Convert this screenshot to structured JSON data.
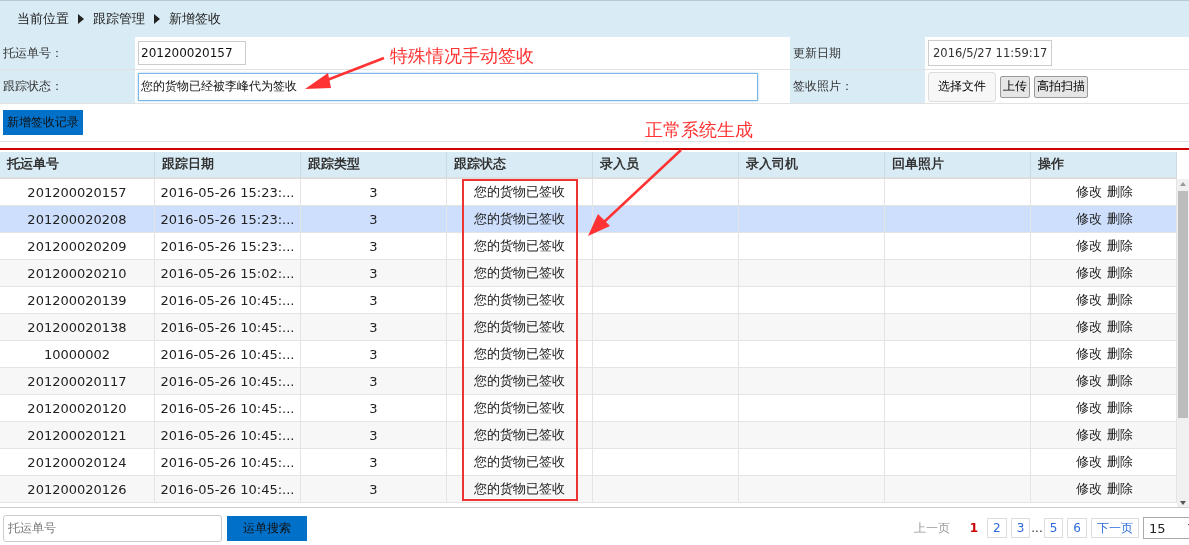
{
  "breadcrumb": [
    "当前位置",
    "跟踪管理",
    "新增签收"
  ],
  "form": {
    "waybill": {
      "label": "托运单号：",
      "value": "201200020157"
    },
    "update_date": {
      "label": "更新日期",
      "value": "2016/5/27 11:59:17"
    },
    "status": {
      "label": "跟踪状态：",
      "value": "您的货物已经被李峰代为签收",
      "focused": true
    },
    "photo": {
      "label": "签收照片：",
      "buttons": [
        "选择文件",
        "上传",
        "高拍扫描"
      ]
    }
  },
  "add_button": "新增签收记录",
  "annotations": [
    {
      "text": "特殊情况手动签收"
    },
    {
      "text": "正常系统生成"
    }
  ],
  "table": {
    "columns": [
      "托运单号",
      "跟踪日期",
      "跟踪类型",
      "跟踪状态",
      "录入员",
      "录入司机",
      "回单照片",
      "操作"
    ],
    "rows": [
      {
        "cells": [
          "201200020157",
          "2016-05-26 15:23:...",
          "3",
          "您的货物已签收",
          "",
          "",
          ""
        ],
        "actions": [
          "修改",
          "删除"
        ],
        "selected": false
      },
      {
        "cells": [
          "201200020208",
          "2016-05-26 15:23:...",
          "3",
          "您的货物已签收",
          "",
          "",
          ""
        ],
        "actions": [
          "修改",
          "删除"
        ],
        "selected": true
      },
      {
        "cells": [
          "201200020209",
          "2016-05-26 15:23:...",
          "3",
          "您的货物已签收",
          "",
          "",
          ""
        ],
        "actions": [
          "修改",
          "删除"
        ],
        "selected": false
      },
      {
        "cells": [
          "201200020210",
          "2016-05-26 15:02:...",
          "3",
          "您的货物已签收",
          "",
          "",
          ""
        ],
        "actions": [
          "修改",
          "删除"
        ],
        "selected": false
      },
      {
        "cells": [
          "201200020139",
          "2016-05-26 10:45:...",
          "3",
          "您的货物已签收",
          "",
          "",
          ""
        ],
        "actions": [
          "修改",
          "删除"
        ],
        "selected": false
      },
      {
        "cells": [
          "201200020138",
          "2016-05-26 10:45:...",
          "3",
          "您的货物已签收",
          "",
          "",
          ""
        ],
        "actions": [
          "修改",
          "删除"
        ],
        "selected": false
      },
      {
        "cells": [
          "10000002",
          "2016-05-26 10:45:...",
          "3",
          "您的货物已签收",
          "",
          "",
          ""
        ],
        "actions": [
          "修改",
          "删除"
        ],
        "selected": false
      },
      {
        "cells": [
          "201200020117",
          "2016-05-26 10:45:...",
          "3",
          "您的货物已签收",
          "",
          "",
          ""
        ],
        "actions": [
          "修改",
          "删除"
        ],
        "selected": false
      },
      {
        "cells": [
          "201200020120",
          "2016-05-26 10:45:...",
          "3",
          "您的货物已签收",
          "",
          "",
          ""
        ],
        "actions": [
          "修改",
          "删除"
        ],
        "selected": false
      },
      {
        "cells": [
          "201200020121",
          "2016-05-26 10:45:...",
          "3",
          "您的货物已签收",
          "",
          "",
          ""
        ],
        "actions": [
          "修改",
          "删除"
        ],
        "selected": false
      },
      {
        "cells": [
          "201200020124",
          "2016-05-26 10:45:...",
          "3",
          "您的货物已签收",
          "",
          "",
          ""
        ],
        "actions": [
          "修改",
          "删除"
        ],
        "selected": false
      },
      {
        "cells": [
          "201200020126",
          "2016-05-26 10:45:...",
          "3",
          "您的货物已签收",
          "",
          "",
          ""
        ],
        "actions": [
          "修改",
          "删除"
        ],
        "selected": false
      }
    ]
  },
  "search": {
    "placeholder": "托运单号",
    "button": "运单搜索"
  },
  "pagination": {
    "prev": {
      "label": "上一页",
      "disabled": true
    },
    "pages": [
      {
        "kind": "page",
        "label": "1",
        "selected": true
      },
      {
        "kind": "page",
        "label": "2",
        "selected": false
      },
      {
        "kind": "page",
        "label": "3",
        "selected": false
      },
      {
        "kind": "gap",
        "label": "..."
      },
      {
        "kind": "page",
        "label": "5",
        "selected": false
      },
      {
        "kind": "page",
        "label": "6",
        "selected": false
      }
    ],
    "next": {
      "label": "下一页",
      "disabled": false
    },
    "page_size": "15"
  }
}
